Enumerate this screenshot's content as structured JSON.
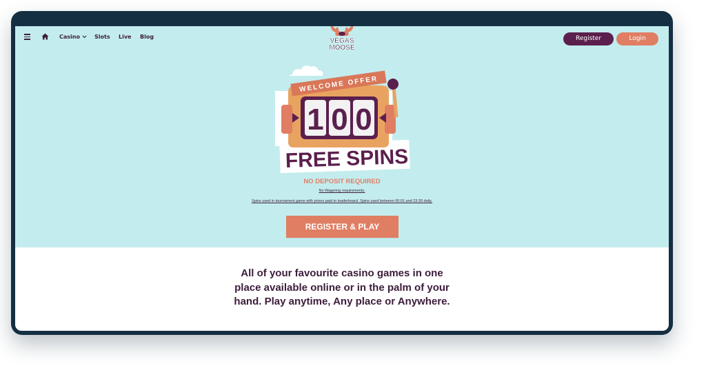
{
  "nav": {
    "menu_icon": "hamburger-icon",
    "home_icon": "home-icon",
    "items": [
      {
        "label": "Casino",
        "has_dropdown": true
      },
      {
        "label": "Slots"
      },
      {
        "label": "Live"
      },
      {
        "label": "Blog"
      }
    ],
    "logo_text": [
      "VEGAS",
      "MOOSE"
    ],
    "register_label": "Register",
    "login_label": "Login"
  },
  "hero": {
    "banner_top": "WELCOME OFFER",
    "banner_digits": [
      "1",
      "0",
      "0"
    ],
    "banner_bottom": "FREE SPINS",
    "no_deposit": "NO DEPOSIT REQUIRED",
    "no_wagering": "No Wagering requirements.",
    "spins_note": "Spins used in tournament game with prizes paid to leaderboard. Spins used between 00:01 and 23:30 daily.",
    "cta_label": "REGISTER & PLAY"
  },
  "tagline": "All of your favourite casino games in one place available online or in the palm of your hand. Play anytime, Any place or Anywhere.",
  "colors": {
    "frame": "#142f42",
    "hero_bg": "#c3ecee",
    "accent": "#e07e63",
    "brand": "#5b1f4d",
    "text": "#3c1c3a"
  }
}
